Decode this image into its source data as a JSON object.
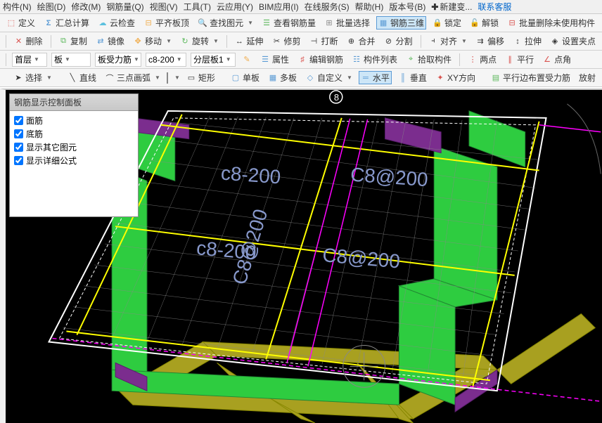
{
  "menubar": {
    "items": [
      "构件(N)",
      "绘图(D)",
      "修改(M)",
      "钢筋量(Q)",
      "视图(V)",
      "工具(T)",
      "云应用(Y)",
      "BIM应用(I)",
      "在线服务(S)",
      "帮助(H)",
      "版本号(B)"
    ],
    "new_variable": "新建变...",
    "contact": "联系客服"
  },
  "toolbar1": {
    "define": "定义",
    "sum_calc": "汇总计算",
    "cloud_check": "云检查",
    "level_top": "平齐板顶",
    "find_element": "查找图元",
    "view_rebar": "查看钢筋量",
    "batch_select": "批量选择",
    "rebar_3d": "钢筋三维",
    "lock": "锁定",
    "unlock": "解锁",
    "batch_delete_unused": "批量删除未使用构件"
  },
  "toolbar2": {
    "delete": "删除",
    "copy": "复制",
    "mirror": "镜像",
    "move": "移动",
    "rotate": "旋转",
    "extend": "延伸",
    "trim": "修剪",
    "break": "打断",
    "merge": "合并",
    "split": "分割",
    "align": "对齐",
    "offset": "偏移",
    "stretch": "拉伸",
    "grip": "设置夹点"
  },
  "toolbar3": {
    "floor": "首层",
    "category": "板",
    "subcategory": "板受力筋",
    "spec": "c8-200",
    "layer": "分层板1",
    "properties": "属性",
    "edit_rebar": "编辑钢筋",
    "component_list": "构件列表",
    "pick_element": "拾取构件",
    "two_point": "两点",
    "parallel": "平行",
    "point_angle": "点角"
  },
  "toolbar4": {
    "select": "选择",
    "line": "直线",
    "arc3p": "三点画弧",
    "rect": "矩形",
    "single_board": "单板",
    "multi_board": "多板",
    "custom": "自定义",
    "horizontal": "水平",
    "vertical": "垂直",
    "xy_direction": "XY方向",
    "parallel_edge": "平行边布置受力筋",
    "radial": "放射"
  },
  "panel": {
    "title": "钢筋显示控制面板",
    "items": [
      "面筋",
      "底筋",
      "显示其它图元",
      "显示详细公式"
    ]
  },
  "viewport": {
    "node_label": "8",
    "rebar_labels": [
      "c8-200",
      "C8@200",
      "c8-200",
      "C8@200",
      "C8@200"
    ]
  }
}
